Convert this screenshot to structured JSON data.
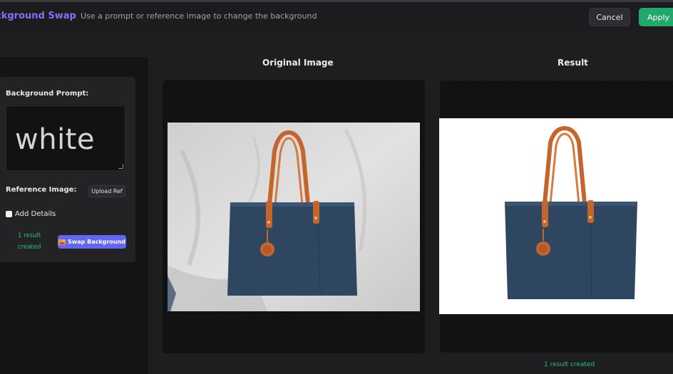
{
  "header": {
    "title": "ckground Swap",
    "subtitle": "Use a prompt or reference image to change the background",
    "cancel_label": "Cancel",
    "apply_label": "Apply",
    "accent_color": "#8b6cf6",
    "apply_color": "#22a86a"
  },
  "sidebar": {
    "prompt_label": "Background Prompt:",
    "prompt_value": "white",
    "reference_label": "Reference Image:",
    "upload_label": "Upload Ref",
    "add_details_label": "Add Details",
    "add_details_checked": false,
    "status_line1": "1 result",
    "status_line2": "created",
    "swap_icon": "picture-icon",
    "swap_label": "Swap Background",
    "swap_color": "#6366f1"
  },
  "main": {
    "original_title": "Original Image",
    "result_title": "Result",
    "result_status": "1 result created",
    "status_color": "#2fbf7a"
  }
}
